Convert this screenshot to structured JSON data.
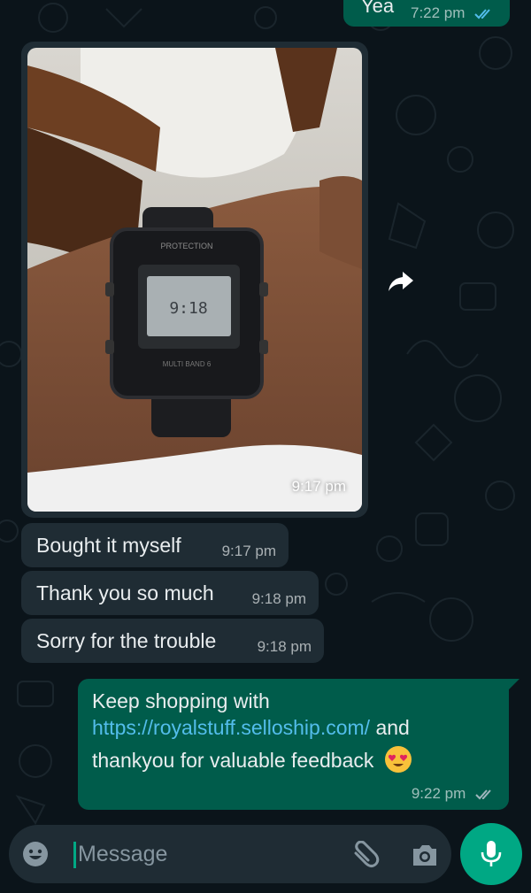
{
  "conversation": {
    "messages": [
      {
        "direction": "out",
        "text": "Yea",
        "time": "7:22 pm",
        "status": "read"
      },
      {
        "direction": "in",
        "type": "photo",
        "caption": "",
        "time": "9:17 pm"
      },
      {
        "direction": "in",
        "text": "Bought it myself",
        "time": "9:17 pm"
      },
      {
        "direction": "in",
        "text": "Thank you so much",
        "time": "9:18 pm"
      },
      {
        "direction": "in",
        "text": "Sorry for the trouble",
        "time": "9:18 pm"
      },
      {
        "direction": "out",
        "line1": "Keep shopping with",
        "link": "https://royalstuff.selloship.com/",
        "after_link": " and",
        "line3": "thankyou for valuable feedback",
        "emoji": "smiling-face-with-heart-eyes",
        "time": "9:22 pm",
        "status": "read"
      }
    ]
  },
  "photo": {
    "description_icon": "wristwatch-photo",
    "watch_display": "9:18"
  },
  "composer": {
    "placeholder": "Message"
  },
  "icons": {
    "forward": "forward-icon",
    "emoji": "emoji-icon",
    "attach": "paperclip-icon",
    "camera": "camera-icon",
    "mic": "microphone-icon",
    "read_ticks": "double-check-icon"
  },
  "colors": {
    "background": "#0b141a",
    "incoming_bubble": "#1f2c34",
    "outgoing_bubble": "#005c4b",
    "link": "#53bdeb",
    "accent": "#00a884",
    "read_ticks": "#53bdeb"
  }
}
